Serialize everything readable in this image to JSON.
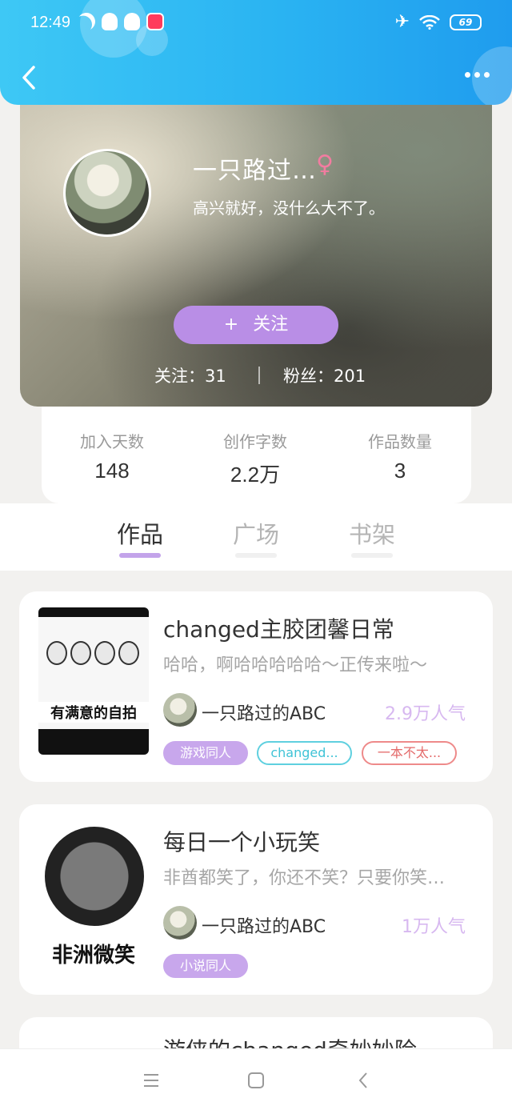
{
  "status_bar": {
    "time": "12:49",
    "battery": "69"
  },
  "header": {
    "back_icon": "chevron-left-icon",
    "more_icon": "more-dots-icon"
  },
  "profile": {
    "nickname": "一只路过…",
    "gender_symbol": "♀",
    "bio": "高兴就好，没什么大不了。",
    "follow_plus": "+",
    "follow_label": "关注",
    "following_text": "关注：31",
    "fans_text": "粉丝：201"
  },
  "stats": [
    {
      "label": "加入天数",
      "value": "148"
    },
    {
      "label": "创作字数",
      "value": "2.2万"
    },
    {
      "label": "作品数量",
      "value": "3"
    }
  ],
  "tabs": [
    {
      "label": "作品",
      "active": true
    },
    {
      "label": "广场",
      "active": false
    },
    {
      "label": "书架",
      "active": false
    }
  ],
  "works": [
    {
      "title": "changed主胶团馨日常",
      "description": "哈哈，啊哈哈哈哈哈～正传来啦～",
      "cover_caption": "有满意的自拍",
      "author": "一只路过的ABC",
      "popularity": "2.9万人气",
      "tags": [
        "游戏同人",
        "changed...",
        "一本不太..."
      ]
    },
    {
      "title": "每日一个小玩笑",
      "description": "非酋都笑了，你还不笑？只要你笑…",
      "cover_caption": "非洲微笑",
      "author": "一只路过的ABC",
      "popularity": "1万人气",
      "tags": [
        "小说同人"
      ]
    },
    {
      "title": "游侠的changed奇妙妙险"
    }
  ],
  "colors": {
    "header_blue": "#2ab3f2",
    "accent_purple": "#b98ee6",
    "gender_pink": "#f27ca0"
  }
}
